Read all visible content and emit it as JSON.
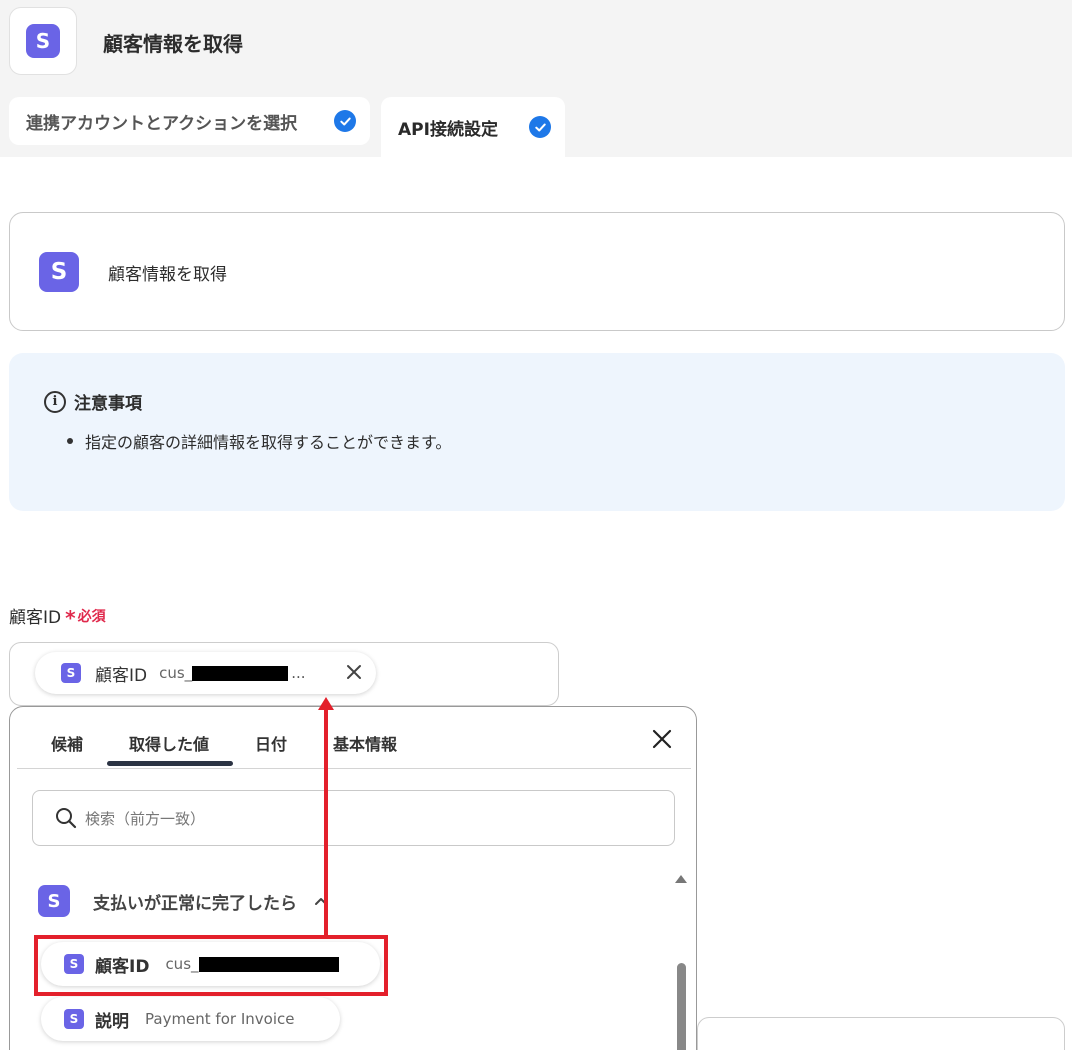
{
  "header": {
    "title": "顧客情報を取得",
    "tabs": [
      {
        "label": "連携アカウントとアクションを選択"
      },
      {
        "label": "API接続設定"
      }
    ]
  },
  "app": {
    "logo_letter": "S",
    "brand_color": "#6a64e6"
  },
  "action_card": {
    "title": "顧客情報を取得"
  },
  "notice": {
    "heading": "注意事項",
    "items": [
      "指定の顧客の詳細情報を取得することができます。"
    ]
  },
  "field": {
    "label": "顧客ID",
    "required_mark": "*",
    "required_text": "必須",
    "chip": {
      "label": "顧客ID",
      "value_prefix": "cus_",
      "ellipsis": "..."
    }
  },
  "picker": {
    "tabs": [
      "候補",
      "取得した値",
      "日付",
      "基本情報"
    ],
    "active_tab": "取得した値",
    "search_placeholder": "検索（前方一致）",
    "group_title": "支払いが正常に完了したら",
    "items": [
      {
        "label": "顧客ID",
        "value": "cus_"
      },
      {
        "label": "説明",
        "value": "Payment for Invoice"
      }
    ]
  },
  "colors": {
    "accent": "#1e78e8",
    "required": "#e0294c",
    "annotation": "#e3202b"
  }
}
